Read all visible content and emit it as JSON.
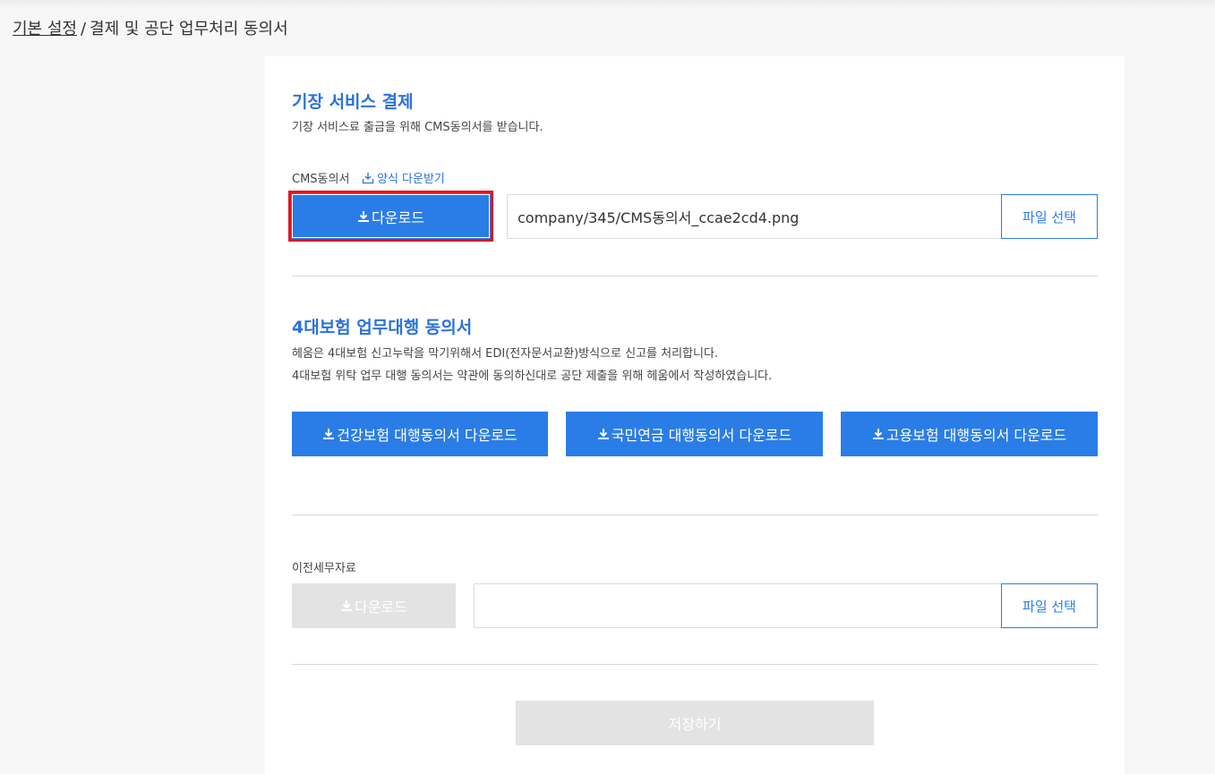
{
  "breadcrumb": {
    "parent": "기본 설정",
    "separator": "/",
    "current": "결제 및 공단 업무처리 동의서"
  },
  "cms_section": {
    "title": "기장 서비스 결제",
    "description": "기장 서비스료 출금을 위해 CMS동의서를 받습니다.",
    "field_label": "CMS동의서",
    "form_link": "양식 다운받기",
    "download_button": "다운로드",
    "file_value": "company/345/CMS동의서_ccae2cd4.png",
    "file_select_button": "파일 선택"
  },
  "insurance_section": {
    "title": "4대보험 업무대행 동의서",
    "description_lines": [
      "헤움은 4대보험 신고누락을 막기위해서 EDI(전자문서교환)방식으로 신고를 처리합니다.",
      "4대보험 위탁 업무 대행 동의서는 약관에 동의하신대로 공단 제출을 위해 헤움에서 작성하였습니다."
    ],
    "buttons": [
      "건강보험 대행동의서 다운로드",
      "국민연금 대행동의서 다운로드",
      "고용보험 대행동의서 다운로드"
    ]
  },
  "tax_section": {
    "field_label": "이전세무자료",
    "download_button": "다운로드",
    "file_value": "",
    "file_select_button": "파일 선택"
  },
  "save_button": "저장하기",
  "colors": {
    "accent": "#2a7de6",
    "title": "#2a72dc",
    "highlight_border": "#e0161e",
    "disabled": "#e3e3e3"
  }
}
